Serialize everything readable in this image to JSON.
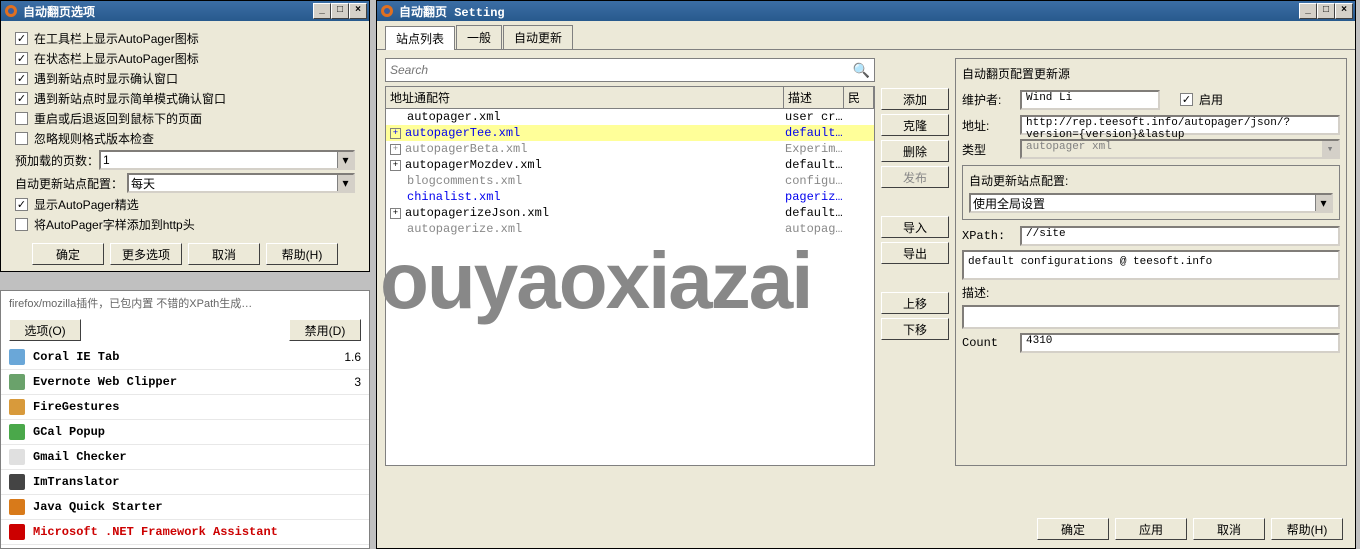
{
  "watermark": "ouyaoxiazai",
  "options_window": {
    "title": "自动翻页选项",
    "checks": [
      {
        "checked": true,
        "label": "在工具栏上显示AutoPager图标"
      },
      {
        "checked": true,
        "label": "在状态栏上显示AutoPager图标"
      },
      {
        "checked": true,
        "label": "遇到新站点时显示确认窗口"
      },
      {
        "checked": true,
        "label": "遇到新站点时显示简单模式确认窗口"
      },
      {
        "checked": false,
        "label": "重启或后退返回到鼠标下的页面"
      },
      {
        "checked": false,
        "label": "忽略规则格式版本检查"
      }
    ],
    "preload_label": "预加载的页数：",
    "preload_value": "1",
    "autoupdate_label": "自动更新站点配置：",
    "autoupdate_value": "每天",
    "checks2": [
      {
        "checked": true,
        "label": "显示AutoPager精选"
      },
      {
        "checked": false,
        "label": "将AutoPager字样添加到http头"
      }
    ],
    "buttons": {
      "ok": "确定",
      "more": "更多选项",
      "cancel": "取消",
      "help": "帮助(H)"
    }
  },
  "addon_panel": {
    "header_snip": "firefox/mozilla插件，已包内置  不错的XPath生成…",
    "opt_btn": "选项(O)",
    "disable_btn": "禁用(D)",
    "items": [
      {
        "name": "Coral IE Tab",
        "ver": "1.6",
        "color": "#6aa7d8"
      },
      {
        "name": "Evernote Web Clipper",
        "ver": "3",
        "color": "#6aa26b"
      },
      {
        "name": "FireGestures",
        "ver": "",
        "color": "#d89a3b"
      },
      {
        "name": "GCal Popup",
        "ver": "",
        "color": "#4aa84a"
      },
      {
        "name": "Gmail Checker",
        "ver": "",
        "color": "#e0e0e0"
      },
      {
        "name": "ImTranslator",
        "ver": "",
        "color": "#444"
      },
      {
        "name": "Java Quick Starter",
        "ver": "",
        "color": "#d87a1a"
      },
      {
        "name": "Microsoft .NET Framework Assistant",
        "ver": "",
        "color": "#cc0000",
        "danger": true
      }
    ]
  },
  "settings_window": {
    "title": "自动翻页 Setting",
    "tabs": [
      "站点列表",
      "一般",
      "自动更新"
    ],
    "active_tab": 0,
    "search_placeholder": "Search",
    "columns": {
      "c1": "地址通配符",
      "c2": "描述",
      "c3": "民"
    },
    "rows": [
      {
        "exp": null,
        "name": "autopager.xml",
        "desc": "user cr…",
        "cls": ""
      },
      {
        "exp": "+",
        "name": "autopagerTee.xml",
        "desc": "default…",
        "cls": "selected link"
      },
      {
        "exp": "+",
        "name": "autopagerBeta.xml",
        "desc": "Experim…",
        "cls": "gray"
      },
      {
        "exp": "+",
        "name": "autopagerMozdev.xml",
        "desc": "default…",
        "cls": ""
      },
      {
        "exp": null,
        "name": "blogcomments.xml",
        "desc": "configu…",
        "cls": "gray"
      },
      {
        "exp": null,
        "name": "chinalist.xml",
        "desc": "pageriz…",
        "cls": "link"
      },
      {
        "exp": "+",
        "name": "autopagerizeJson.xml",
        "desc": "default…",
        "cls": ""
      },
      {
        "exp": null,
        "name": "autopagerize.xml",
        "desc": "autopag…",
        "cls": "gray"
      }
    ],
    "side_buttons": {
      "add": "添加",
      "clone": "克隆",
      "delete": "删除",
      "publish": "发布",
      "import": "导入",
      "export": "导出",
      "up": "上移",
      "down": "下移"
    },
    "right": {
      "group_title": "自动翻页配置更新源",
      "maintainer_label": "维护者:",
      "maintainer": "Wind Li",
      "enable_label": "启用",
      "enable_checked": true,
      "url_label": "地址:",
      "url": "http://rep.teesoft.info/autopager/json/?version={version}&lastup",
      "type_label": "类型",
      "type_value": "autopager xml",
      "subgroup_title": "自动更新站点配置:",
      "subgroup_value": "使用全局设置",
      "xpath_label": "XPath:",
      "xpath": "//site",
      "default_conf": "default configurations @ teesoft.info",
      "desc_label": "描述:",
      "count_label": "Count",
      "count": "4310"
    },
    "bottom": {
      "ok": "确定",
      "apply": "应用",
      "cancel": "取消",
      "help": "帮助(H)"
    }
  }
}
